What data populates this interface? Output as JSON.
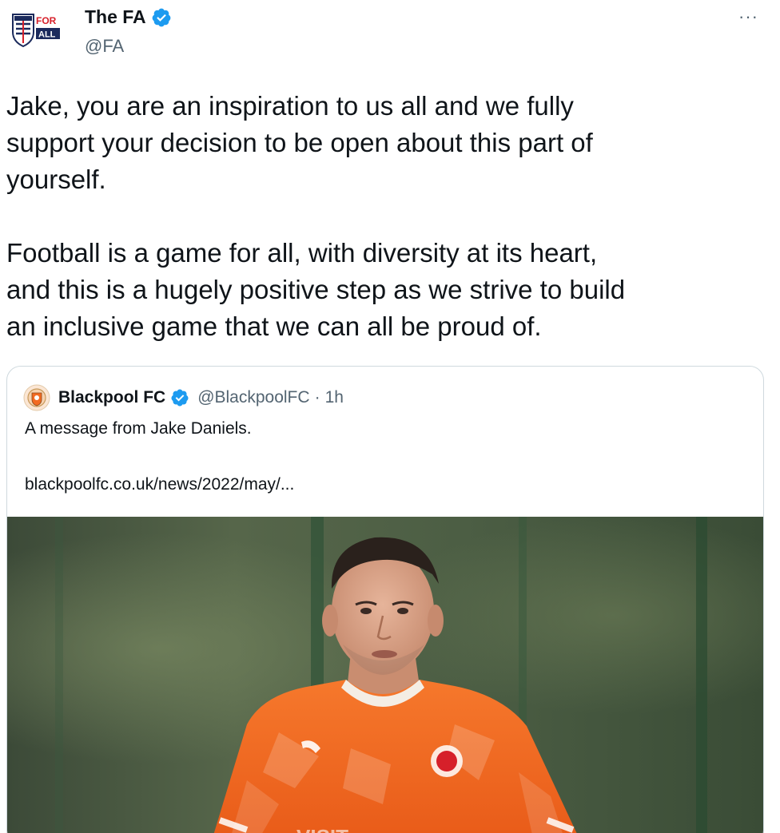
{
  "tweet": {
    "author_name": "The FA",
    "author_handle": "@FA",
    "more_label": "···",
    "paragraphs": [
      "Jake, you are an inspiration to us all and we fully\nsupport your decision to be open about this part of\nyourself.",
      "Football is a game for all, with diversity at its heart,\nand this is a hugely positive step as we strive to build\nan inclusive game that we can all be proud of."
    ]
  },
  "avatar": {
    "badge_top": "FOR",
    "badge_bottom": "ALL"
  },
  "quoted_tweet": {
    "author_name": "Blackpool FC",
    "author_handle": "@BlackpoolFC",
    "separator": "·",
    "time": "1h",
    "text": "A message from Jake Daniels.",
    "link": "blackpoolfc.co.uk/news/2022/may/..."
  },
  "photo": {
    "shirt_text": "VISIT"
  },
  "colors": {
    "verified": "#1d9bf0",
    "text_primary": "#0f1419",
    "text_secondary": "#536471",
    "border": "#cfd9de",
    "shirt_orange": "#f26a21",
    "badge_red": "#d6202a"
  }
}
